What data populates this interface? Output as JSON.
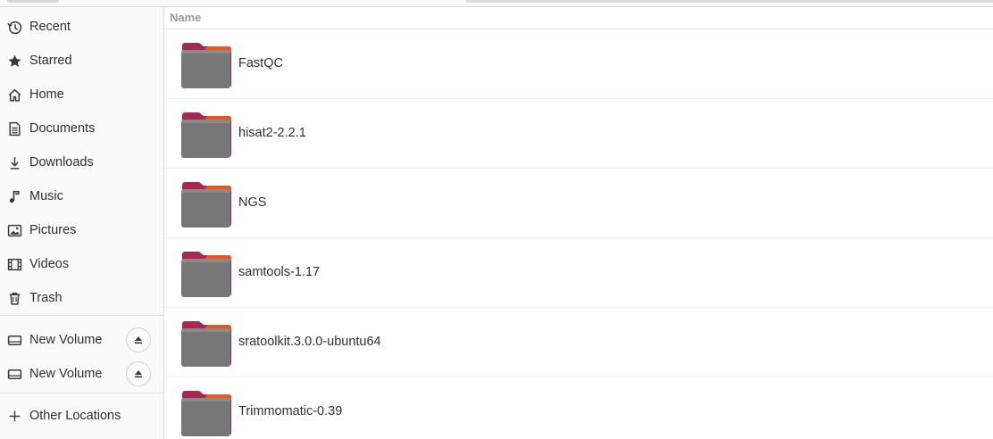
{
  "sidebar": {
    "places": [
      {
        "label": "Recent",
        "icon": "clock-icon"
      },
      {
        "label": "Starred",
        "icon": "star-icon"
      },
      {
        "label": "Home",
        "icon": "home-icon"
      },
      {
        "label": "Documents",
        "icon": "document-icon"
      },
      {
        "label": "Downloads",
        "icon": "download-icon"
      },
      {
        "label": "Music",
        "icon": "music-icon"
      },
      {
        "label": "Pictures",
        "icon": "picture-icon"
      },
      {
        "label": "Videos",
        "icon": "video-icon"
      },
      {
        "label": "Trash",
        "icon": "trash-icon"
      }
    ],
    "volumes": [
      {
        "label": "New Volume",
        "icon": "drive-icon"
      },
      {
        "label": "New Volume",
        "icon": "drive-icon"
      }
    ],
    "other_locations": {
      "label": "Other Locations",
      "icon": "plus-icon"
    }
  },
  "list": {
    "column_name": "Name",
    "items": [
      {
        "name": "FastQC"
      },
      {
        "name": "hisat2-2.2.1"
      },
      {
        "name": "NGS"
      },
      {
        "name": "samtools-1.17"
      },
      {
        "name": "sratoolkit.3.0.0-ubuntu64"
      },
      {
        "name": "Trimmomatic-0.39"
      }
    ]
  },
  "colors": {
    "folder_body": "#777777",
    "folder_tab": "#a62a4f",
    "folder_accent": "#e95420",
    "sidebar_bg": "#fafafa"
  }
}
